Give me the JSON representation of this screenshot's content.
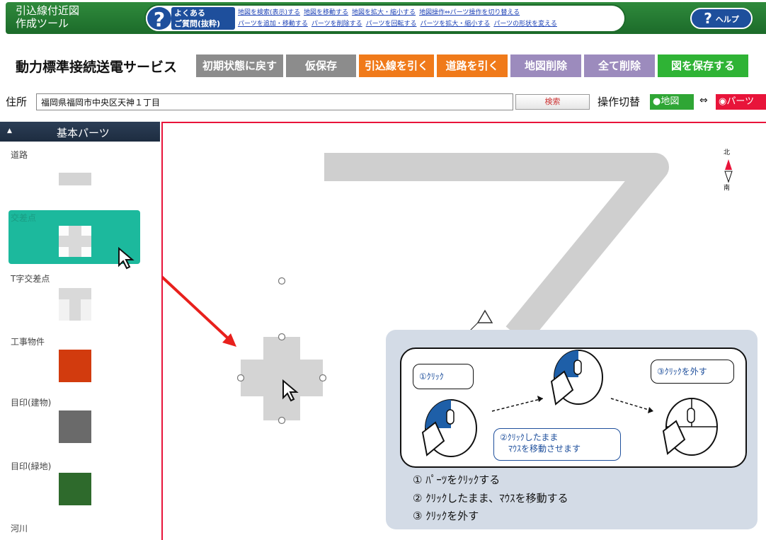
{
  "header": {
    "app_title_line1": "引込線付近図",
    "app_title_line2": "作成ツール",
    "faq_badge_line1": "よくある",
    "faq_badge_line2": "ご質問(抜粋)",
    "faq_links_row1": [
      "地図を検索(表示)する",
      "地図を移動する",
      "地図を拡大・縮小する",
      "地図操作⇔パーツ操作を切り替える"
    ],
    "faq_links_row2": [
      "パーツを追加・移動する",
      "パーツを削除する",
      "パーツを回転する",
      "パーツを拡大・縮小する",
      "パーツの形状を変える"
    ],
    "help_label": "ヘルプ"
  },
  "service_title": "動力標準接続送電サービス",
  "toolbar": {
    "buttons": [
      {
        "label": "初期状態に戻す",
        "color": "#8c8c8c"
      },
      {
        "label": "仮保存",
        "color": "#8c8c8c"
      },
      {
        "label": "引込線を引く",
        "color": "#f07a1a"
      },
      {
        "label": "道路を引く",
        "color": "#f07a1a"
      },
      {
        "label": "地図削除",
        "color": "#9c8bbd"
      },
      {
        "label": "全て削除",
        "color": "#9c8bbd"
      },
      {
        "label": "図を保存する",
        "color": "#2fb335"
      }
    ]
  },
  "address": {
    "label": "住所",
    "value": "福岡県福岡市中央区天神１丁目",
    "search_label": "検索",
    "mode_label": "操作切替",
    "mode_map": "地図",
    "mode_arrow": "⇔",
    "mode_parts": "パーツ"
  },
  "sidebar": {
    "title": "基本パーツ",
    "parts": [
      {
        "label": "道路"
      },
      {
        "label": "交差点"
      },
      {
        "label": "T字交差点"
      },
      {
        "label": "工事物件"
      },
      {
        "label": "目印(建物)"
      },
      {
        "label": "目印(緑地)"
      },
      {
        "label": "河川"
      }
    ]
  },
  "map": {
    "compass_north": "北",
    "compass_south": "南"
  },
  "guide": {
    "bubble1": "①ｸﾘｯｸ",
    "bubble2_line1": "②ｸﾘｯｸしたまま",
    "bubble2_line2": "ﾏｳｽを移動させます",
    "bubble3": "③ｸﾘｯｸを外す",
    "step1": "① ﾊﾟｰﾂをｸﾘｯｸする",
    "step2": "② ｸﾘｯｸしたまま、ﾏｳｽを移動する",
    "step3": "③ ｸﾘｯｸを外す"
  }
}
